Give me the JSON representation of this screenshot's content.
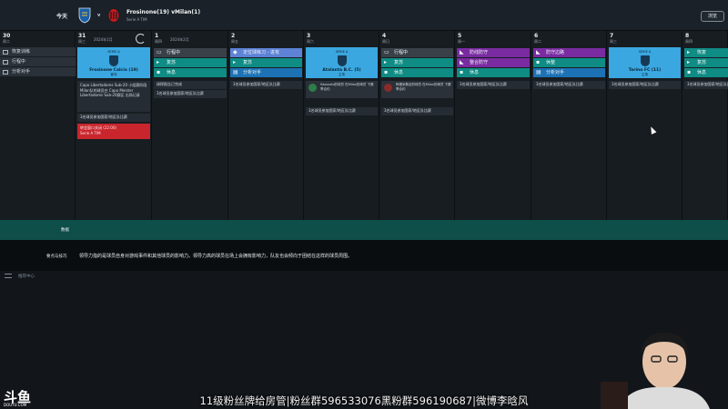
{
  "header": {
    "today_label": "今天",
    "vs_label": "v",
    "match_title": "Frosinone(19) vMilan(1)",
    "match_sub": "Serie A TIM",
    "browse_label": "浏览"
  },
  "calendar": {
    "month_label_1": "2024年1月",
    "month_label_2": "2024年2月",
    "days": [
      {
        "num": "30",
        "name": "周二"
      },
      {
        "num": "31",
        "name": "周三"
      },
      {
        "num": "1",
        "name": "周四"
      },
      {
        "num": "2",
        "name": "周五"
      },
      {
        "num": "3",
        "name": "周六"
      },
      {
        "num": "4",
        "name": "周日"
      },
      {
        "num": "5",
        "name": "周一"
      },
      {
        "num": "6",
        "name": "周二"
      },
      {
        "num": "7",
        "name": "周三"
      },
      {
        "num": "8",
        "name": "周四"
      }
    ]
  },
  "sidemenu": {
    "items": [
      {
        "label": "恢复训练"
      },
      {
        "label": "行程中"
      },
      {
        "label": "分析对手"
      }
    ]
  },
  "col31": {
    "match": {
      "top": "SERIE A",
      "team": "Frosinone Calcio (19)",
      "comp": "客场"
    },
    "note1": "Capo Libertadores Sub-20 小组赛阶段 Milan队的球员在 Capo Meister Libertadores Sub-20赛区 出场记录",
    "note2": "3名球员参加国家/地区队比赛",
    "note3": "转会窗口关闭 (22:00)",
    "note3_sub": "Serie A TIM"
  },
  "col1": {
    "act1": "行程中",
    "act2": "复苏",
    "act3": "休息",
    "note1": "球探报告已完成",
    "note2": "3名球员参加国家/地区队比赛"
  },
  "col2": {
    "act1": "定位球练习 - 进攻",
    "act2": "复苏",
    "act3": "分析对手",
    "note1": "3名球员参加国家/地区队比赛"
  },
  "col3": {
    "match": {
      "top": "SERIE A",
      "team": "Atalanta B.C. (5)",
      "comp": "主场"
    },
    "scout1": "Sassuolo的球员 在Milan的球员 下赛季合约",
    "note1": "3名球员参加国家/地区队比赛"
  },
  "col4": {
    "act1": "行程中",
    "act2": "复苏",
    "act3": "休息",
    "scout1": "阿德米勒尼的球员 在Milan的球员 下赛季合约",
    "note1": "3名球员参加国家/地区队比赛"
  },
  "col5": {
    "act1": "防线防守",
    "act2": "整合防守",
    "act3": "休息",
    "note1": "3名球员参加国家/地区队比赛"
  },
  "col6": {
    "act1": "防守边路",
    "act2": "休整",
    "act3": "分析对手",
    "note1": "3名球员参加国家/地区队比赛"
  },
  "col7": {
    "match": {
      "top": "SERIE A",
      "team": "Torino FC (11)",
      "comp": "主场"
    },
    "note1": "3名球员参加国家/地区队比赛"
  },
  "col8": {
    "act1": "恢复",
    "act2": "复苏",
    "act3": "休息",
    "note1": "3名球员参加国家/地区队比赛"
  },
  "footer": {
    "green_label": "数据",
    "desc_label": "要点与技巧",
    "desc_text": "领导力指的是球员自身对游戏事件和其他球员的影响力。领导力高的球员在场上会拥有影响力，队友也会倾向于团结在这样的球员周围。",
    "lower_label": "推荐中心"
  },
  "stream": {
    "logo": "斗鱼",
    "logo_url": "DOUYU.COM",
    "overlay": "11级粉丝牌给房管|粉丝群596533076黑粉群596190687|微博李晗风"
  },
  "colors": {
    "teal": "#0f8c84",
    "blue_match": "#3aa7e0",
    "purple": "#7a2ba1",
    "red_note": "#c9252d",
    "green_bar": "#0f4f49"
  }
}
